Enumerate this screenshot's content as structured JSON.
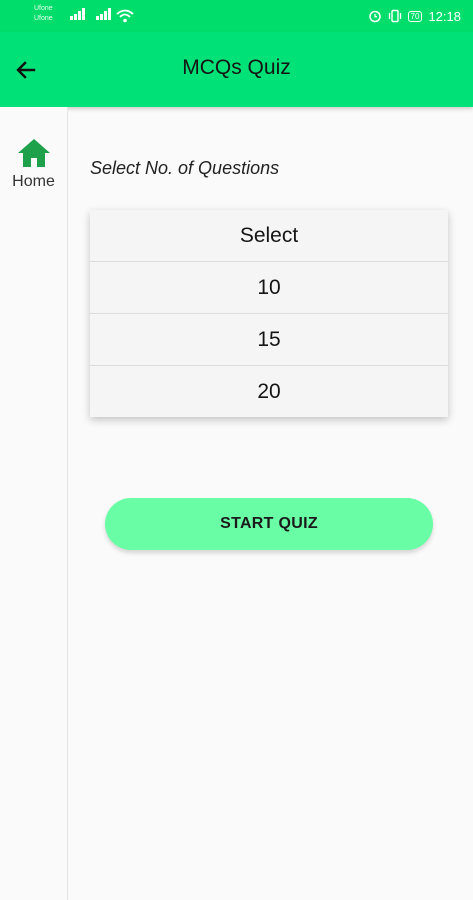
{
  "status_bar": {
    "carrier_1": "Ufone",
    "carrier_2": "Ufone",
    "battery": "70",
    "time": "12:18"
  },
  "toolbar": {
    "title": "MCQs Quiz",
    "back_icon": "arrow-left-icon"
  },
  "rail": {
    "items": [
      {
        "label": "Home",
        "icon": "home-icon",
        "color": "#1ea14a"
      }
    ]
  },
  "quiz": {
    "prompt": "Select No. of Questions",
    "options": [
      "Select",
      "10",
      "15",
      "20"
    ],
    "start_label": "START QUIZ"
  },
  "colors": {
    "status_bar": "#00dd6b",
    "toolbar": "#00e277",
    "button": "#69fea5",
    "accent": "#1ea14a"
  }
}
